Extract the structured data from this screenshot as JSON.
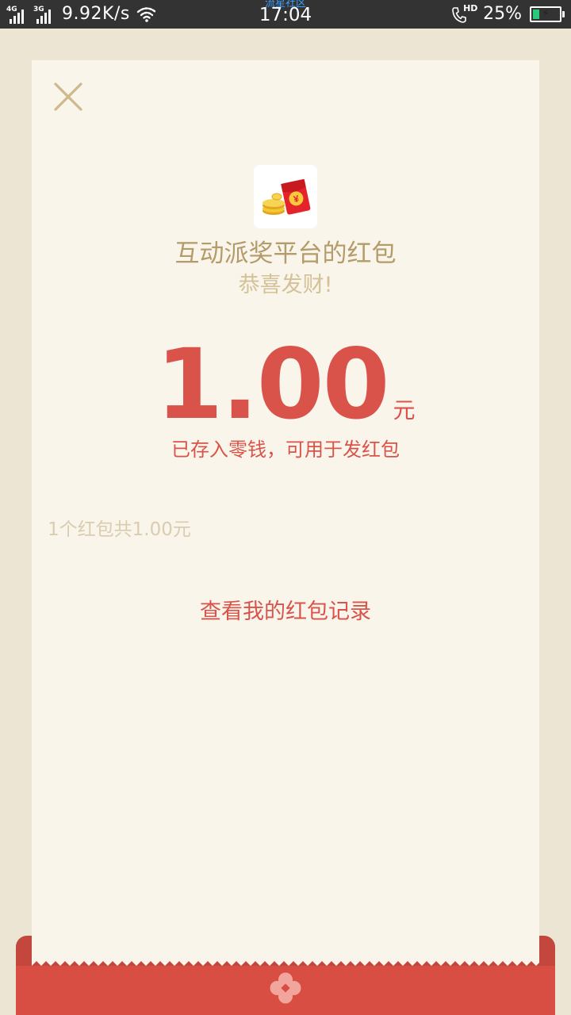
{
  "status_bar": {
    "signal_1_type": "4G",
    "signal_2_type": "3G",
    "net_speed": "9.92K/s",
    "watermark": "流星社区",
    "time": "17:04",
    "call_badge": "HD",
    "battery_percent": "25%",
    "battery_level": 0.25,
    "battery_charging": true
  },
  "icons": {
    "close": "close-icon",
    "app": "red-envelope-coins-icon",
    "bottom": "flower-icon",
    "wifi": "wifi-icon",
    "call": "hd-call-icon",
    "battery": "battery-icon"
  },
  "colors": {
    "accent_red": "#d9534a",
    "gold_title": "#b49b6a",
    "envelope_red": "#d94e42",
    "paper": "#faf5eb",
    "background": "#ede5d3"
  },
  "envelope": {
    "sender_title": "互动派奖平台的红包",
    "greeting": "恭喜发财!",
    "amount": "1.00",
    "unit": "元",
    "stored_note": "已存入零钱，可用于发红包",
    "summary": "1个红包共1.00元",
    "records_link": "查看我的红包记录"
  }
}
